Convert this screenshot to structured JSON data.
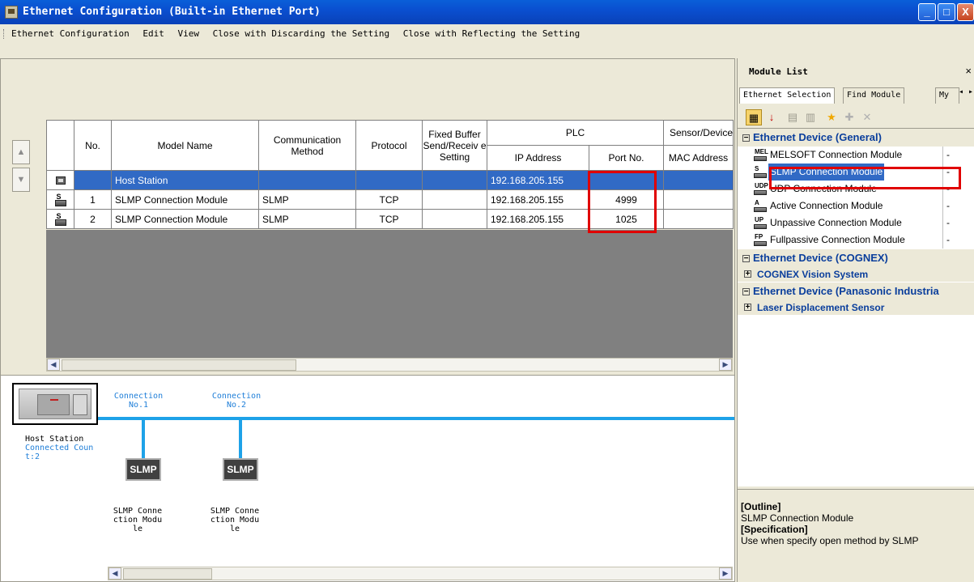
{
  "window": {
    "title": "Ethernet Configuration (Built-in Ethernet Port)",
    "buttons": {
      "minimize": "_",
      "maximize": "□",
      "close": "X"
    }
  },
  "menu": {
    "items": [
      "Ethernet Configuration",
      "Edit",
      "View",
      "Close with Discarding the Setting",
      "Close with Reflecting the Setting"
    ]
  },
  "grid": {
    "headers": {
      "no": "No.",
      "model_name": "Model Name",
      "comm_method": "Communication Method",
      "protocol": "Protocol",
      "fixed_buffer": "Fixed Buffer Send/Receiv e Setting",
      "plc": "PLC",
      "ip_address": "IP Address",
      "port_no": "Port No.",
      "sensor_device": "Sensor/Device",
      "mac_address": "MAC Address"
    },
    "rows": [
      {
        "no": "",
        "model": "Host Station",
        "method": "",
        "protocol": "",
        "fixed": "",
        "ip": "192.168.205.155",
        "port": "",
        "mac": "",
        "icon": "host-station-icon"
      },
      {
        "no": "1",
        "model": "SLMP Connection Module",
        "method": "SLMP",
        "protocol": "TCP",
        "fixed": "",
        "ip": "192.168.205.155",
        "port": "4999",
        "mac": "",
        "icon": "slmp-module-icon"
      },
      {
        "no": "2",
        "model": "SLMP Connection Module",
        "method": "SLMP",
        "protocol": "TCP",
        "fixed": "",
        "ip": "192.168.205.155",
        "port": "1025",
        "mac": "",
        "icon": "slmp-module-icon"
      }
    ]
  },
  "diagram": {
    "host_label": "Host Station",
    "host_count": "Connected Coun t:2",
    "connections": [
      {
        "label_line1": "Connection",
        "label_line2": "No.1",
        "box": "SLMP",
        "module_l1": "SLMP Conne",
        "module_l2": "ction Modu",
        "module_l3": "le"
      },
      {
        "label_line1": "Connection",
        "label_line2": "No.2",
        "box": "SLMP",
        "module_l1": "SLMP Conne",
        "module_l2": "ction Modu",
        "module_l3": "le"
      }
    ]
  },
  "module_list": {
    "title": "Module List",
    "close": "×",
    "tabs": [
      "Ethernet Selection",
      "Find Module",
      "My"
    ],
    "categories": [
      {
        "label": "Ethernet Device (General)",
        "items": [
          {
            "label": "MELSOFT Connection Module",
            "value": "-",
            "icon": "melsoft-icon"
          },
          {
            "label": "SLMP Connection Module",
            "value": "-",
            "icon": "slmp-module-icon"
          },
          {
            "label": "UDP Connection Module",
            "value": "-",
            "icon": "udp-module-icon"
          },
          {
            "label": "Active Connection Module",
            "value": "-",
            "icon": "active-module-icon"
          },
          {
            "label": "Unpassive Connection Module",
            "value": "-",
            "icon": "unpassive-module-icon"
          },
          {
            "label": "Fullpassive Connection Module",
            "value": "-",
            "icon": "fullpassive-module-icon"
          }
        ]
      },
      {
        "label": "Ethernet Device (COGNEX)",
        "sub": "COGNEX Vision System"
      },
      {
        "label": "Ethernet Device (Panasonic Industria",
        "sub": "Laser Displacement Sensor"
      }
    ],
    "outline_heading": "[Outline]",
    "outline_text": "SLMP Connection Module",
    "spec_heading": "[Specification]",
    "spec_text": "Use when specify open method by SLMP"
  },
  "colors": {
    "selection": "#316ac5",
    "bus": "#1ea2e8",
    "highlight": "#e00000",
    "title_bar": "#0a4fd0"
  }
}
